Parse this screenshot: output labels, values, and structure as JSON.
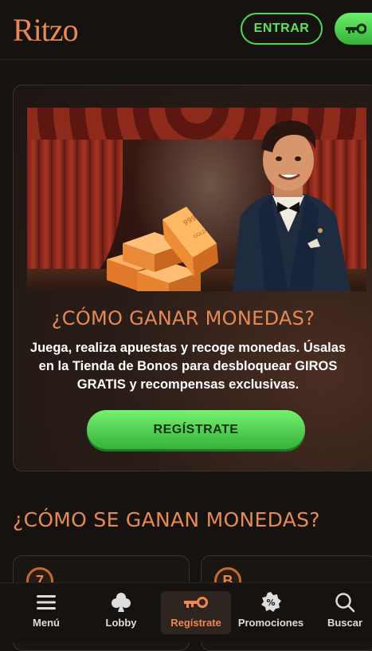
{
  "header": {
    "logo_text": "Ritzo",
    "login_label": "ENTRAR",
    "register_icon": "key-icon"
  },
  "promo_card": {
    "title": "¿CÓMO GANAR MONEDAS?",
    "description": "Juega, realiza apuestas y recoge monedas. Úsalas en la Tienda de Bonos para desbloquear GIROS GRATIS y recompensas exclusivas.",
    "button_label": "REGÍSTRATE",
    "gold_bar_text_1": "999",
    "gold_bar_text_2": "GOLD"
  },
  "section": {
    "title": "¿CÓMO SE GANAN MONEDAS?"
  },
  "bottom_nav": {
    "items": [
      {
        "label": "Menú",
        "icon": "hamburger-icon"
      },
      {
        "label": "Lobby",
        "icon": "club-icon"
      },
      {
        "label": "Regístrate",
        "icon": "key-icon",
        "active": true
      },
      {
        "label": "Promociones",
        "icon": "percent-badge-icon"
      },
      {
        "label": "Buscar",
        "icon": "search-icon"
      }
    ]
  },
  "colors": {
    "accent_orange": "#e58a55",
    "accent_green": "#5ee35f",
    "background": "#161210"
  }
}
